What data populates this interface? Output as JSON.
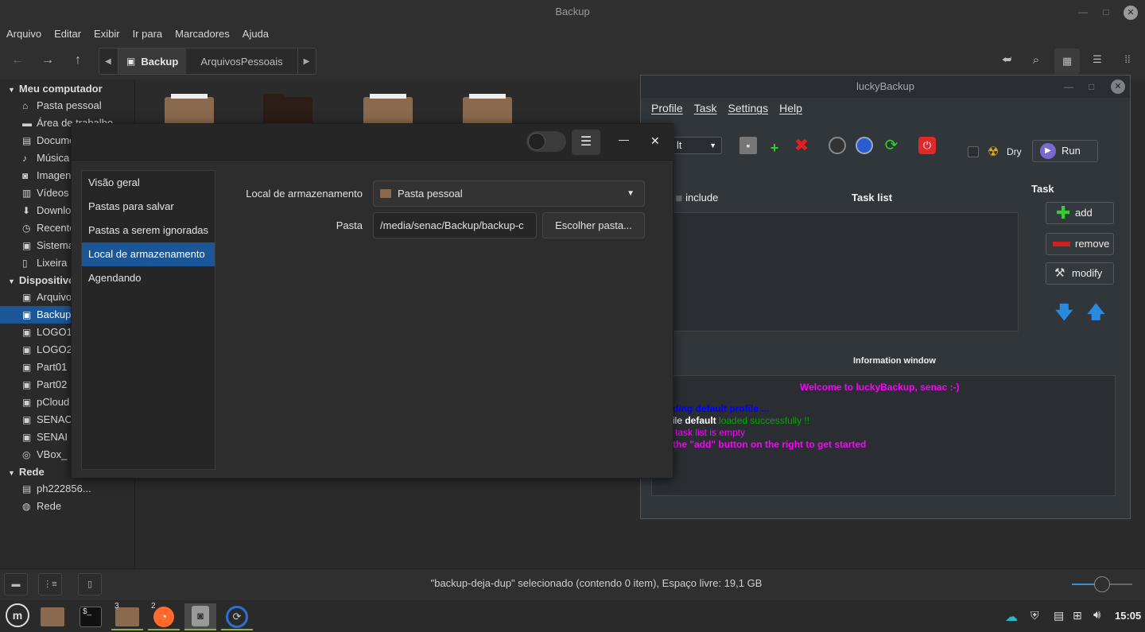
{
  "window": {
    "title": "Backup"
  },
  "menu": [
    "Arquivo",
    "Editar",
    "Exibir",
    "Ir para",
    "Marcadores",
    "Ajuda"
  ],
  "path": {
    "segments": [
      "Backup",
      "ArquivosPessoais"
    ]
  },
  "sidebar": {
    "sections": {
      "computer": "Meu computador",
      "devices": "Dispositivos",
      "network": "Rede"
    },
    "computer_items": [
      {
        "label": "Pasta pessoal",
        "icon": "home-icon"
      },
      {
        "label": "Área de trabalho",
        "icon": "desktop-icon"
      },
      {
        "label": "Documentos",
        "icon": "document-icon"
      },
      {
        "label": "Música",
        "icon": "music-icon"
      },
      {
        "label": "Imagens",
        "icon": "image-icon"
      },
      {
        "label": "Vídeos",
        "icon": "video-icon"
      },
      {
        "label": "Downloads",
        "icon": "download-icon"
      },
      {
        "label": "Recentes",
        "icon": "recent-icon"
      },
      {
        "label": "Sistema de arquivos",
        "icon": "drive-icon"
      },
      {
        "label": "Lixeira",
        "icon": "trash-icon"
      }
    ],
    "device_items": [
      {
        "label": "ArquivosPessoais",
        "icon": "drive-icon"
      },
      {
        "label": "Backup",
        "icon": "drive-icon",
        "selected": true
      },
      {
        "label": "LOGO1",
        "icon": "drive-icon"
      },
      {
        "label": "LOGO2",
        "icon": "drive-icon"
      },
      {
        "label": "Part01",
        "icon": "drive-icon"
      },
      {
        "label": "Part02",
        "icon": "drive-icon"
      },
      {
        "label": "pCloud",
        "icon": "drive-icon"
      },
      {
        "label": "SENAC",
        "icon": "drive-icon"
      },
      {
        "label": "SENAI",
        "icon": "drive-icon"
      },
      {
        "label": "VBox_",
        "icon": "disc-icon"
      }
    ],
    "network_items": [
      {
        "label": "ph222856...",
        "icon": "server-icon"
      },
      {
        "label": "Rede",
        "icon": "network-icon"
      }
    ]
  },
  "status": {
    "text": "\"backup-deja-dup\" selecionado (contendo 0 item), Espaço livre: 19,1 GB"
  },
  "dialog": {
    "nav": [
      "Visão geral",
      "Pastas para salvar",
      "Pastas a serem ignoradas",
      "Local de armazenamento",
      "Agendando"
    ],
    "storage_label": "Local de armazenamento",
    "storage_value": "Pasta pessoal",
    "folder_label": "Pasta",
    "folder_value": "/media/senac/Backup/backup-c",
    "choose_button": "Escolher pasta..."
  },
  "lucky": {
    "title": "luckyBackup",
    "menu": [
      "Profile",
      "Task",
      "Settings",
      "Help"
    ],
    "profile_value": "lt",
    "dry_label": "Dry",
    "run_label": "Run",
    "include_label": "include",
    "task_list_label": "Task list",
    "task_label": "Task",
    "add_label": "add",
    "remove_label": "remove",
    "modify_label": "modify",
    "info_title": "Information window",
    "info_welcome": "Welcome to luckyBackup, senac :-)",
    "info_line1": "ding default profile ...",
    "info_line2_a": "ile ",
    "info_line2_b": "default",
    "info_line2_c": " loaded successfully !!",
    "info_line3": "task list is empty",
    "info_line4": " the \"add\" button on the right to get started"
  },
  "taskbar": {
    "clock": "15:05",
    "badges": [
      "3",
      "2"
    ]
  },
  "colors": {
    "accent": "#1b5797",
    "folder": "#8a6a4e",
    "magenta": "#ff00ff",
    "blue": "#0000ff",
    "green": "#00aa00"
  }
}
